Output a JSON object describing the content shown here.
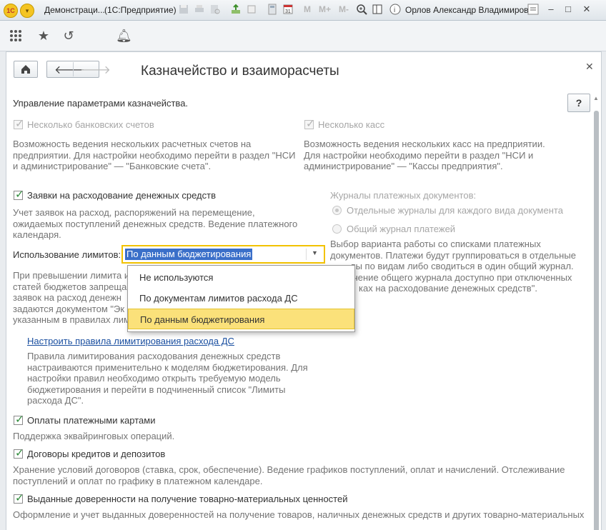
{
  "window": {
    "title": "Демонстраци... (1С:Предприятие)",
    "title_app": "Демонстраци...",
    "title_suffix": "(1С:Предприятие)",
    "user": "Орлов Александр Владимирович",
    "memory_buttons": [
      "M",
      "M+",
      "M-"
    ]
  },
  "form": {
    "title": "Казначейство и взаиморасчеты",
    "intro": "Управление параметрами казначейства.",
    "help_label": "?"
  },
  "settings": {
    "bank_accounts": {
      "label": "Несколько банковских счетов",
      "checked": true,
      "disabled": true,
      "desc": [
        "Возможность ведения нескольких расчетных счетов на",
        "предприятии. Для настройки необходимо перейти в раздел \"НСИ",
        "и администрирование\" — \"Банковские счета\"."
      ]
    },
    "cash_desks": {
      "label": "Несколько касс",
      "checked": true,
      "disabled": true,
      "desc": [
        "Возможность ведения нескольких касс на предприятии.",
        "Для настройки необходимо перейти в раздел \"НСИ и",
        "администрирование\" — \"Кассы предприятия\"."
      ]
    },
    "requests": {
      "label": "Заявки на расходование денежных средств",
      "checked": true,
      "desc": [
        "Учет заявок на расход, распоряжений на перемещение,",
        "ожидаемых поступлений денежных средств. Ведение платежного",
        "календаря."
      ]
    },
    "journals": {
      "title": "Журналы платежных документов:",
      "option1": "Отдельные журналы для каждого вида документа",
      "option2": "Общий журнал платежей",
      "selected": "option1",
      "desc": [
        "Выбор варианта работы со списками платежных",
        "документов. Платежи будут группироваться в отдельные",
        "лы по видам либо сводиться в один общий журнал.",
        "чение общего журнала доступно при отключенных",
        "ках на расходование денежных средств\"."
      ]
    },
    "limits": {
      "label": "Использование лимитов:",
      "value": "По данным бюджетирования",
      "options": [
        "Не используются",
        "По документам лимитов расхода ДС",
        "По данным бюджетирования"
      ],
      "selected_index": 2,
      "desc": [
        "При превышении лимита и",
        "статей бюджетов запреща",
        "заявок на расход денежн",
        "задаются документом \"Эк",
        "указанным в правилах лим"
      ]
    },
    "limit_rules": {
      "link": "Настроить правила лимитирования расхода ДС",
      "desc": [
        "Правила лимитирования расходования денежных средств",
        "настраиваются применительно к моделям бюджетирования. Для",
        "настройки правил необходимо открыть требуемую модель",
        "бюджетирования и перейти в подчиненный список \"Лимиты",
        "расхода ДС\"."
      ]
    },
    "card_payments": {
      "label": "Оплаты платежными картами",
      "checked": true,
      "desc": [
        "Поддержка эквайринговых операций."
      ]
    },
    "loans": {
      "label": "Договоры кредитов и депозитов",
      "checked": true,
      "desc": [
        "Хранение условий договоров (ставка, срок, обеспечение). Ведение графиков поступлений, оплат и начислений. Отслеживание",
        "поступлений и оплат по графику в платежном календаре."
      ]
    },
    "powers_of_attorney": {
      "label": "Выданные доверенности на получение товарно-материальных ценностей",
      "checked": true,
      "desc": [
        "Оформление и учет выданных доверенностей на получение товаров, наличных денежных средств и других товарно-материальных"
      ]
    }
  },
  "colors": {
    "accent": "#f2c200",
    "selection": "#3a6fc9",
    "highlight": "#fbe17a",
    "check": "#2e8b3a",
    "link": "#1a4fa0"
  }
}
